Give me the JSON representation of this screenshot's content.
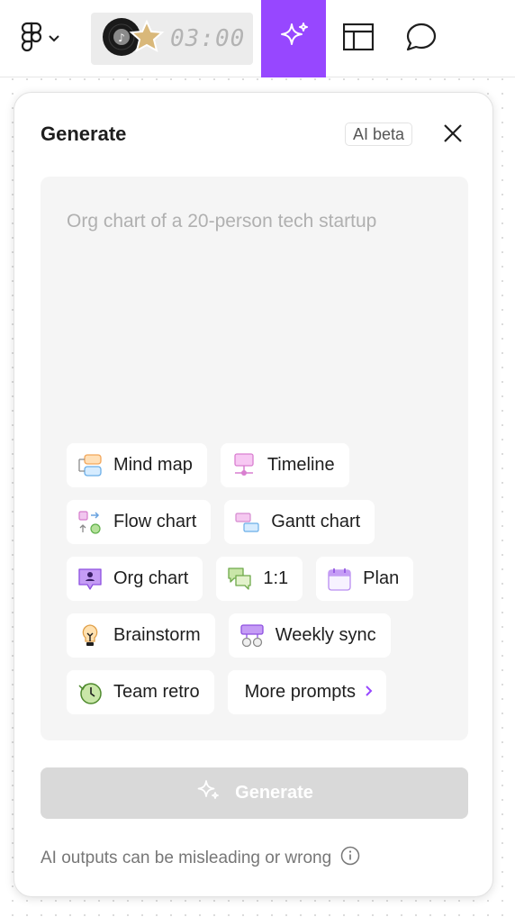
{
  "toolbar": {
    "timer_text": "03:00",
    "accent_color": "#9747ff",
    "icons": [
      "figma-logo-icon",
      "chevron-down-icon",
      "music-disc-icon",
      "star-icon",
      "ai-sparkle-icon",
      "layout-icon",
      "comment-icon"
    ]
  },
  "panel": {
    "title": "Generate",
    "badge": "AI beta",
    "close_icon": "close-icon",
    "prompt_placeholder": "Org chart of a 20-person tech startup",
    "prompt_value": "",
    "chips": [
      {
        "label": "Mind map",
        "icon": "mind-map-icon"
      },
      {
        "label": "Timeline",
        "icon": "timeline-icon"
      },
      {
        "label": "Flow chart",
        "icon": "flow-chart-icon"
      },
      {
        "label": "Gantt chart",
        "icon": "gantt-chart-icon"
      },
      {
        "label": "Org chart",
        "icon": "org-chart-icon"
      },
      {
        "label": "1:1",
        "icon": "one-on-one-icon"
      },
      {
        "label": "Plan",
        "icon": "calendar-icon"
      },
      {
        "label": "Brainstorm",
        "icon": "lightbulb-icon"
      },
      {
        "label": "Weekly sync",
        "icon": "weekly-sync-icon"
      },
      {
        "label": "Team retro",
        "icon": "clock-icon"
      }
    ],
    "more_prompts": "More prompts",
    "generate_label": "Generate",
    "disclaimer": "AI outputs can be misleading or wrong"
  }
}
